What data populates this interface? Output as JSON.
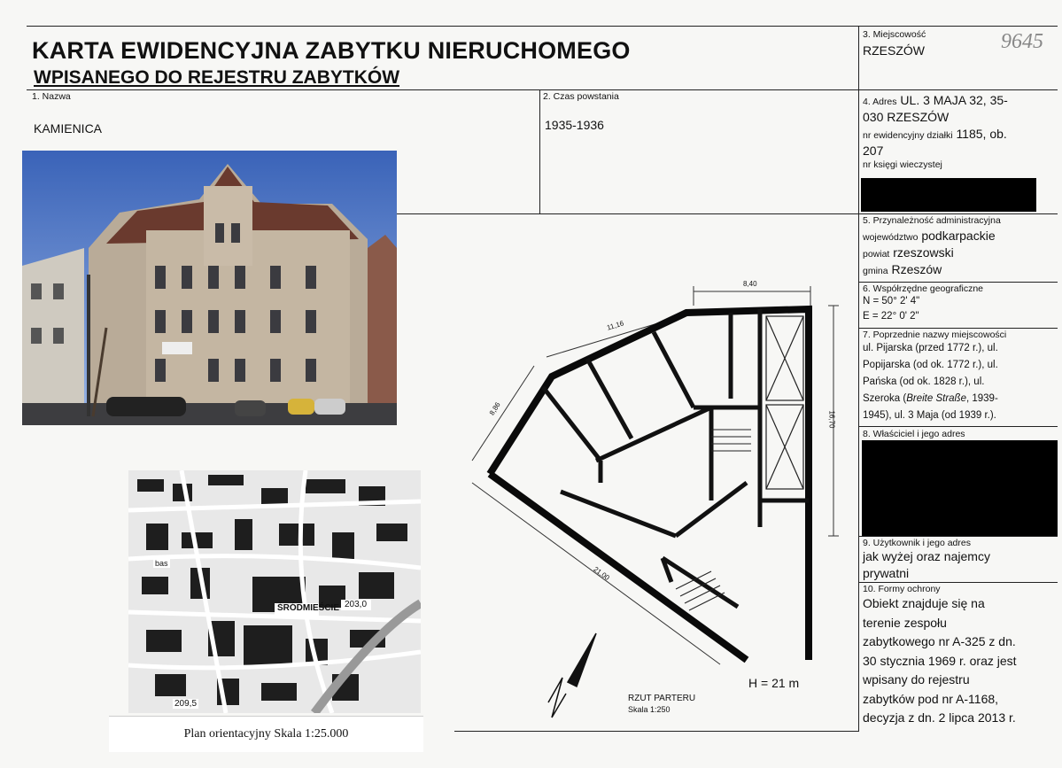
{
  "header": {
    "title_line1": "KARTA EWIDENCYJNA ZABYTKU NIERUCHOMEGO",
    "title_line2": "WPISANEGO DO REJESTRU ZABYTKÓW",
    "handwritten_number": "9645"
  },
  "field1": {
    "label": "1. Nazwa",
    "value": "KAMIENICA"
  },
  "field2": {
    "label": "2. Czas powstania",
    "value": "1935-1936"
  },
  "field3": {
    "label": "3. Miejscowość",
    "value": "RZESZÓW"
  },
  "field4": {
    "label": "4. Adres",
    "address_line1": "UL. 3 MAJA 32, 35-",
    "address_line2": "030 RZESZÓW",
    "plot_label": "nr ewidencyjny działki",
    "plot_value_a": "1185, ob.",
    "plot_value_b": "207",
    "land_register_label": "nr księgi wieczystej"
  },
  "field5": {
    "label": "5. Przynależność administracyjna",
    "voivodeship_label": "województwo",
    "voivodeship_value": "podkarpackie",
    "county_label": "powiat",
    "county_value": "rzeszowski",
    "commune_label": "gmina",
    "commune_value": "Rzeszów"
  },
  "field6": {
    "label": "6. Współrzędne geograficzne",
    "lat": "N = 50° 2' 4\"",
    "lon": "E = 22° 0' 2\""
  },
  "field7": {
    "label": "7. Poprzednie nazwy miejscowości",
    "lines": [
      "ul. Pijarska (przed 1772 r.), ul.",
      "Popijarska (od ok. 1772 r.), ul.",
      "Pańska (od ok. 1828 r.), ul."
    ],
    "line4_prefix": "Szeroka (",
    "line4_italic": "Breite Straße",
    "line4_suffix": ", 1939-",
    "line5": "1945), ul. 3 Maja (od 1939 r.)."
  },
  "field8": {
    "label": "8. Właściciel i jego adres"
  },
  "field9": {
    "label": "9. Użytkownik i jego adres",
    "lines": [
      "jak wyżej oraz najemcy",
      "prywatni"
    ]
  },
  "field10": {
    "label": "10. Formy ochrony",
    "lines": [
      "Obiekt znajduje się na",
      "terenie zespołu",
      "zabytkowego nr A-325 z dn.",
      "30 stycznia 1969 r.  oraz jest",
      "wpisany do rejestru",
      "zabytków pod nr  A-1168,",
      "decyzja z dn. 2 lipca 2013 r."
    ]
  },
  "plan": {
    "dim_top": "8,40",
    "dim_upper": "11,16",
    "dim_left": "8,86",
    "dim_right": "16,70",
    "dim_bottom": "21,00",
    "height": "H = 21 m",
    "caption": "RZUT PARTERU",
    "scale": "Skala 1:250",
    "north": "N"
  },
  "map": {
    "district": "ŚRÓDMIEŚCIE",
    "elev1": "203,0",
    "elev2": "209,5",
    "area": "bas",
    "caption": "Plan orientacyjny  Skala 1:25.000"
  }
}
